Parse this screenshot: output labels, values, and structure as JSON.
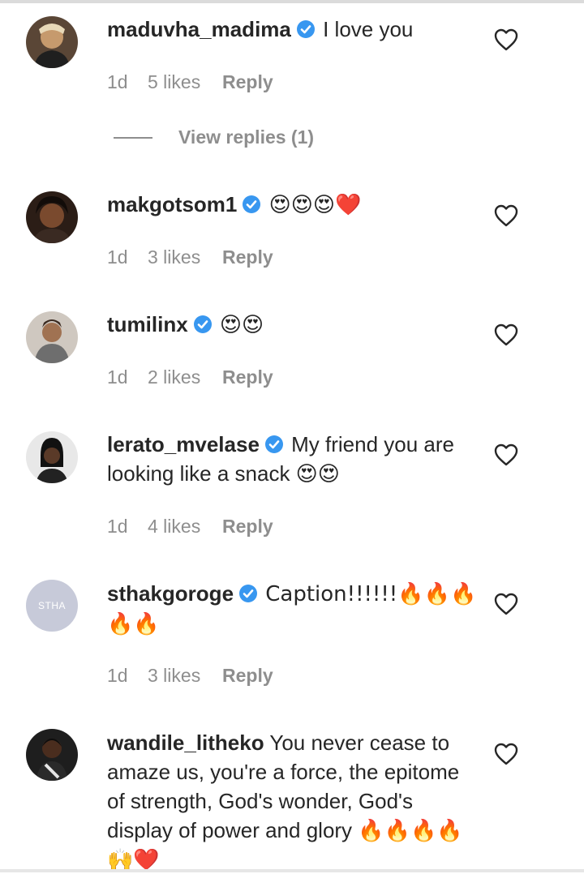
{
  "comments": [
    {
      "username": "maduvha_madima",
      "text": "I love you",
      "time": "1d",
      "likes": "5 likes",
      "reply": "Reply",
      "avatar": "profile-photo",
      "verified": true
    },
    {
      "username": "makgotsom1",
      "text": "😍😍😍❤️",
      "time": "1d",
      "likes": "3 likes",
      "reply": "Reply",
      "avatar": "profile-photo",
      "verified": true
    },
    {
      "username": "tumilinx",
      "text": "😍😍",
      "time": "1d",
      "likes": "2 likes",
      "reply": "Reply",
      "avatar": "profile-photo",
      "verified": true
    },
    {
      "username": "lerato_mvelase",
      "text": "My friend you are looking like a snack 😍😍",
      "time": "1d",
      "likes": "4 likes",
      "reply": "Reply",
      "avatar": "profile-photo",
      "verified": true
    },
    {
      "username": "sthakgoroge",
      "text": "Caption!!!!!!🔥🔥🔥🔥🔥",
      "time": "1d",
      "likes": "3 likes",
      "reply": "Reply",
      "avatar_initials": "STHA",
      "verified": true
    },
    {
      "username": "wandile_litheko",
      "text": "You never cease to amaze us, you're a force, the epitome of strength, God's wonder, God's display of power and glory 🔥🔥🔥🔥🙌❤️",
      "verified": false
    }
  ],
  "view_replies": "View replies (1)",
  "colors": {
    "verified": "#3897f0",
    "text": "#262626",
    "muted": "#8e8e8e"
  },
  "icons": {
    "like": "heart-outline-icon",
    "verified": "verified-badge-icon"
  }
}
